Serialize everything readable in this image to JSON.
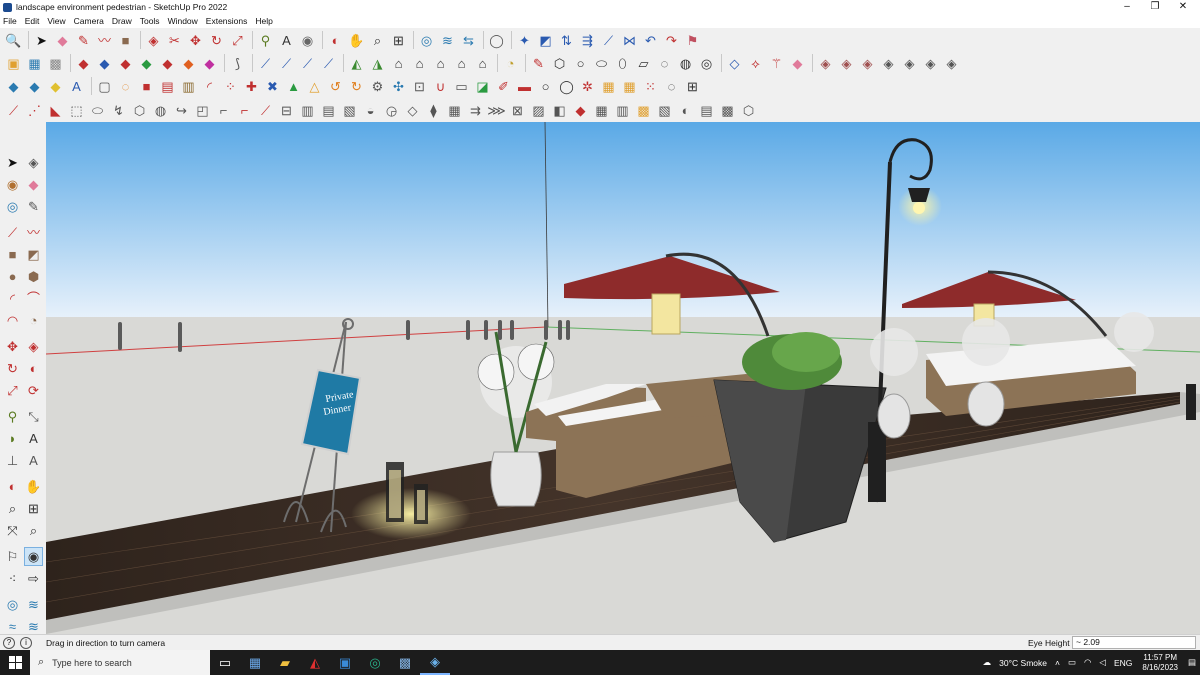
{
  "window": {
    "title": "landscape environment pedestrian - SketchUp Pro 2022",
    "minimize": "–",
    "maximize": "❐",
    "close": "✕"
  },
  "menu": [
    "File",
    "Edit",
    "View",
    "Camera",
    "Draw",
    "Tools",
    "Window",
    "Extensions",
    "Help"
  ],
  "sign": {
    "line1": "Private",
    "line2": "Dinner"
  },
  "status": {
    "message": "Drag in direction to turn camera",
    "value_label": "Eye Height",
    "value": "~ 2.09"
  },
  "taskbar": {
    "search_placeholder": "Type here to search",
    "weather": "30°C  Smoke",
    "language": "ENG",
    "time": "11:57 PM",
    "date": "8/16/2023"
  },
  "colors": {
    "sky_top": "#5aa9e6",
    "sky_bottom": "#e7f1fb",
    "ground": "#d9d9d6",
    "deck": "#3b2d24",
    "umbrella": "#8e2b2b",
    "lamp_glow": "#fff3a0"
  }
}
